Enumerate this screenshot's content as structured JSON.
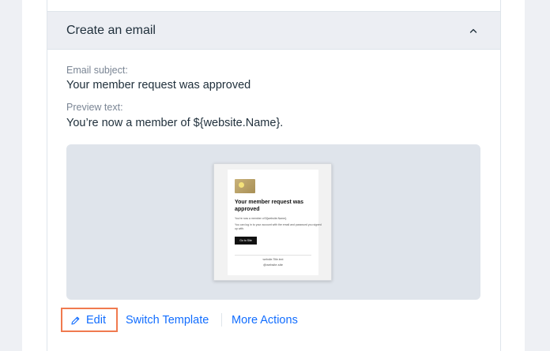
{
  "section": {
    "title": "Create an email"
  },
  "email": {
    "subject_label": "Email subject:",
    "subject_value": "Your member request was approved",
    "preview_label": "Preview text:",
    "preview_value": "You’re now a member of ${website.Name}."
  },
  "thumbnail": {
    "title": "Your member request was approved",
    "line1": "You're now a member of ${website.Name}.",
    "line2": "You can log in to your account with the email and password you signed",
    "line3": "up with.",
    "button": "Go to Site",
    "footer1": "website.Title.text",
    "footer2": "@website.site"
  },
  "actions": {
    "edit": "Edit",
    "switch_template": "Switch Template",
    "more_actions": "More Actions"
  },
  "colors": {
    "accent": "#116dff",
    "highlight": "#f07a4f"
  },
  "icons": {
    "collapse": "chevron-up-icon",
    "edit": "pencil-icon"
  }
}
